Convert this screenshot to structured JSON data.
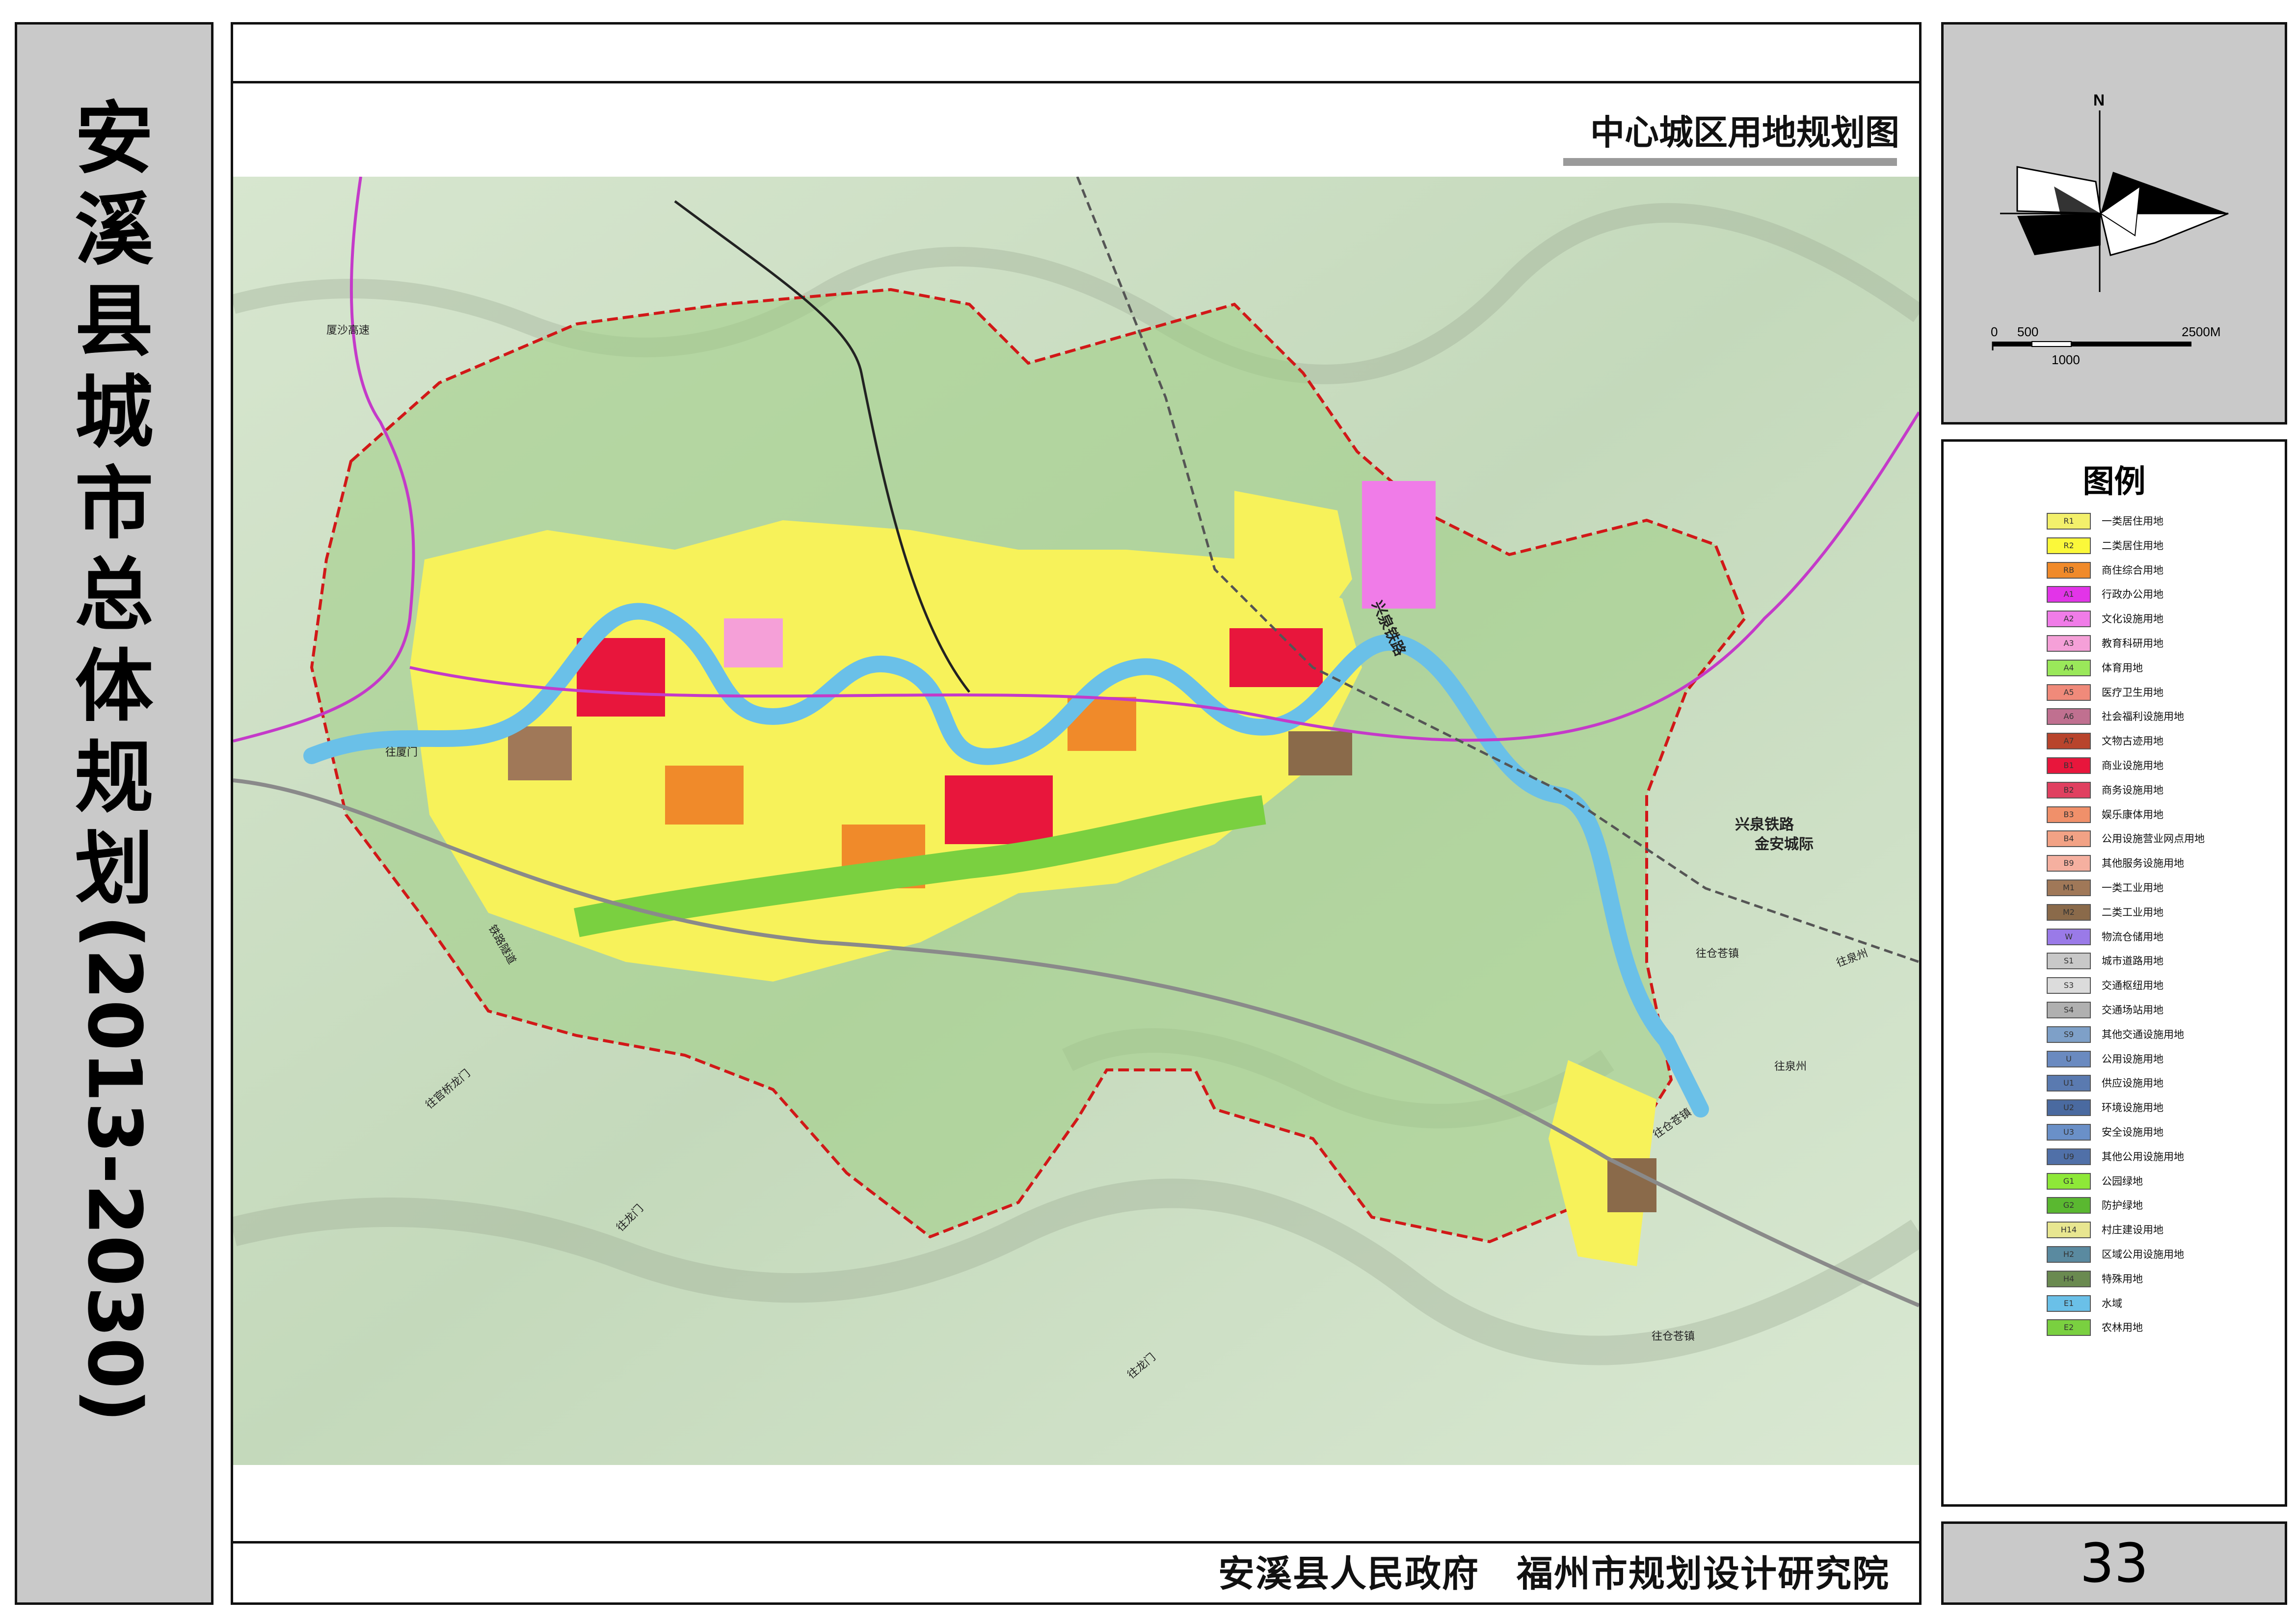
{
  "side_title": {
    "chars": [
      "安",
      "溪",
      "县",
      "城",
      "市",
      "总",
      "体",
      "规",
      "划"
    ],
    "years": "(2013-2030)"
  },
  "map": {
    "title": "中心城区用地规划图",
    "credits": "安溪县人民政府　福州市规划设计研究院",
    "labels": {
      "xiasha_expressway": "厦沙高速",
      "xingquan_rail_north": "兴泉铁路",
      "xingquan_rail_east": "兴泉铁路",
      "jinan_intercity": "金安城际",
      "rail_tunnel": "铁路隧道",
      "to_xiamen": "往厦门",
      "to_guanqiao": "往官桥龙门",
      "to_longmen": "往龙门",
      "to_longmen_2": "往龙门",
      "to_cangzhen": "往仓苍镇",
      "to_quanzhou": "往泉州",
      "to_quanzhou_2": "往泉州",
      "to_cangzhen_2": "往仓苍镇",
      "to_cangzhen_3": "往仓苍镇"
    }
  },
  "compass": {
    "north": "N",
    "scale_0": "0",
    "scale_500": "500",
    "scale_1000": "1000",
    "scale_2500": "2500M"
  },
  "legend": {
    "title": "图例",
    "items": [
      {
        "code": "R1",
        "label": "一类居住用地",
        "color": "#f3f06b"
      },
      {
        "code": "R2",
        "label": "二类居住用地",
        "color": "#fbf83a"
      },
      {
        "code": "RB",
        "label": "商住综合用地",
        "color": "#f08a2a"
      },
      {
        "code": "A1",
        "label": "行政办公用地",
        "color": "#e234e8"
      },
      {
        "code": "A2",
        "label": "文化设施用地",
        "color": "#f07ce8"
      },
      {
        "code": "A3",
        "label": "教育科研用地",
        "color": "#f5a0d8"
      },
      {
        "code": "A4",
        "label": "体育用地",
        "color": "#9ae85a"
      },
      {
        "code": "A5",
        "label": "医疗卫生用地",
        "color": "#f08a7a"
      },
      {
        "code": "A6",
        "label": "社会福利设施用地",
        "color": "#c07090"
      },
      {
        "code": "A7",
        "label": "文物古迹用地",
        "color": "#b8442c"
      },
      {
        "code": "B1",
        "label": "商业设施用地",
        "color": "#e8163c"
      },
      {
        "code": "B2",
        "label": "商务设施用地",
        "color": "#e04060"
      },
      {
        "code": "B3",
        "label": "娱乐康体用地",
        "color": "#f0906a"
      },
      {
        "code": "B4",
        "label": "公用设施营业网点用地",
        "color": "#f2a285"
      },
      {
        "code": "B9",
        "label": "其他服务设施用地",
        "color": "#f5b0a0"
      },
      {
        "code": "M1",
        "label": "一类工业用地",
        "color": "#a07858"
      },
      {
        "code": "M2",
        "label": "二类工业用地",
        "color": "#8a6a4a"
      },
      {
        "code": "W",
        "label": "物流仓储用地",
        "color": "#9a7ae8"
      },
      {
        "code": "S1",
        "label": "城市道路用地",
        "color": "#c8c8c8"
      },
      {
        "code": "S3",
        "label": "交通枢纽用地",
        "color": "#dcdcdc"
      },
      {
        "code": "S4",
        "label": "交通场站用地",
        "color": "#b0b0b0"
      },
      {
        "code": "S9",
        "label": "其他交通设施用地",
        "color": "#7ea0c8"
      },
      {
        "code": "U",
        "label": "公用设施用地",
        "color": "#6a8ac0"
      },
      {
        "code": "U1",
        "label": "供应设施用地",
        "color": "#5a7ab0"
      },
      {
        "code": "U2",
        "label": "环境设施用地",
        "color": "#4a6aa0"
      },
      {
        "code": "U3",
        "label": "安全设施用地",
        "color": "#6a90c8"
      },
      {
        "code": "U9",
        "label": "其他公用设施用地",
        "color": "#5070a8"
      },
      {
        "code": "G1",
        "label": "公园绿地",
        "color": "#8ee838"
      },
      {
        "code": "G2",
        "label": "防护绿地",
        "color": "#5ab830"
      },
      {
        "code": "H14",
        "label": "村庄建设用地",
        "color": "#e8e690"
      },
      {
        "code": "H2",
        "label": "区域公用设施用地",
        "color": "#5a8aa0"
      },
      {
        "code": "H4",
        "label": "特殊用地",
        "color": "#6a8a50"
      },
      {
        "code": "E1",
        "label": "水域",
        "color": "#6ac0e8"
      },
      {
        "code": "E2",
        "label": "农林用地",
        "color": "#7ad040"
      }
    ]
  },
  "page_number": "33"
}
